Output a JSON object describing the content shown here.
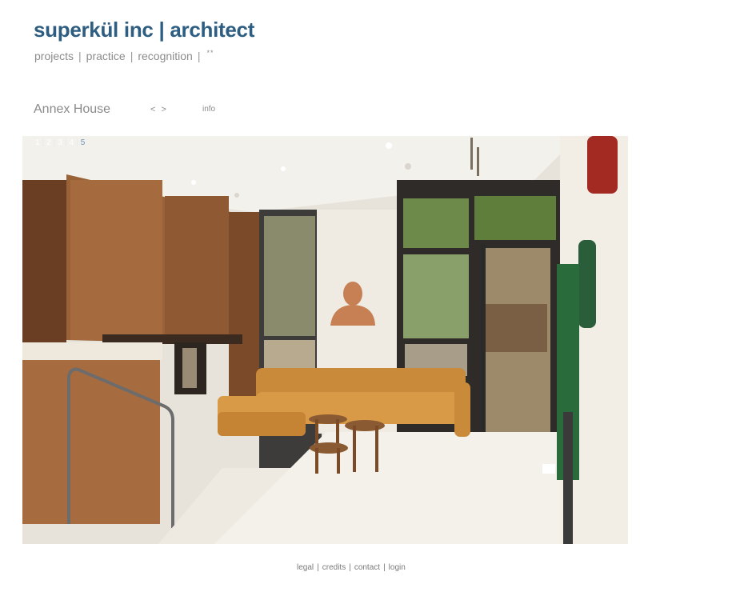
{
  "site": {
    "logo_text": "superkül inc | architect"
  },
  "nav": {
    "items": [
      "projects",
      "practice",
      "recognition"
    ],
    "separator": "|",
    "extra": "**"
  },
  "project": {
    "title": "Annex House",
    "prev_label": "<",
    "next_label": ">",
    "info_label": "info"
  },
  "pager": {
    "pages": [
      "1",
      "2",
      "3",
      "4",
      "5"
    ],
    "current_page": 5,
    "separator": "|"
  },
  "footer": {
    "links": [
      "legal",
      "credits",
      "contact",
      "login"
    ],
    "separator": "|"
  },
  "colors": {
    "logo": "#2d5d80",
    "text": "#8a8a8a",
    "pager_active": "#6f93b5",
    "background": "#ffffff"
  }
}
